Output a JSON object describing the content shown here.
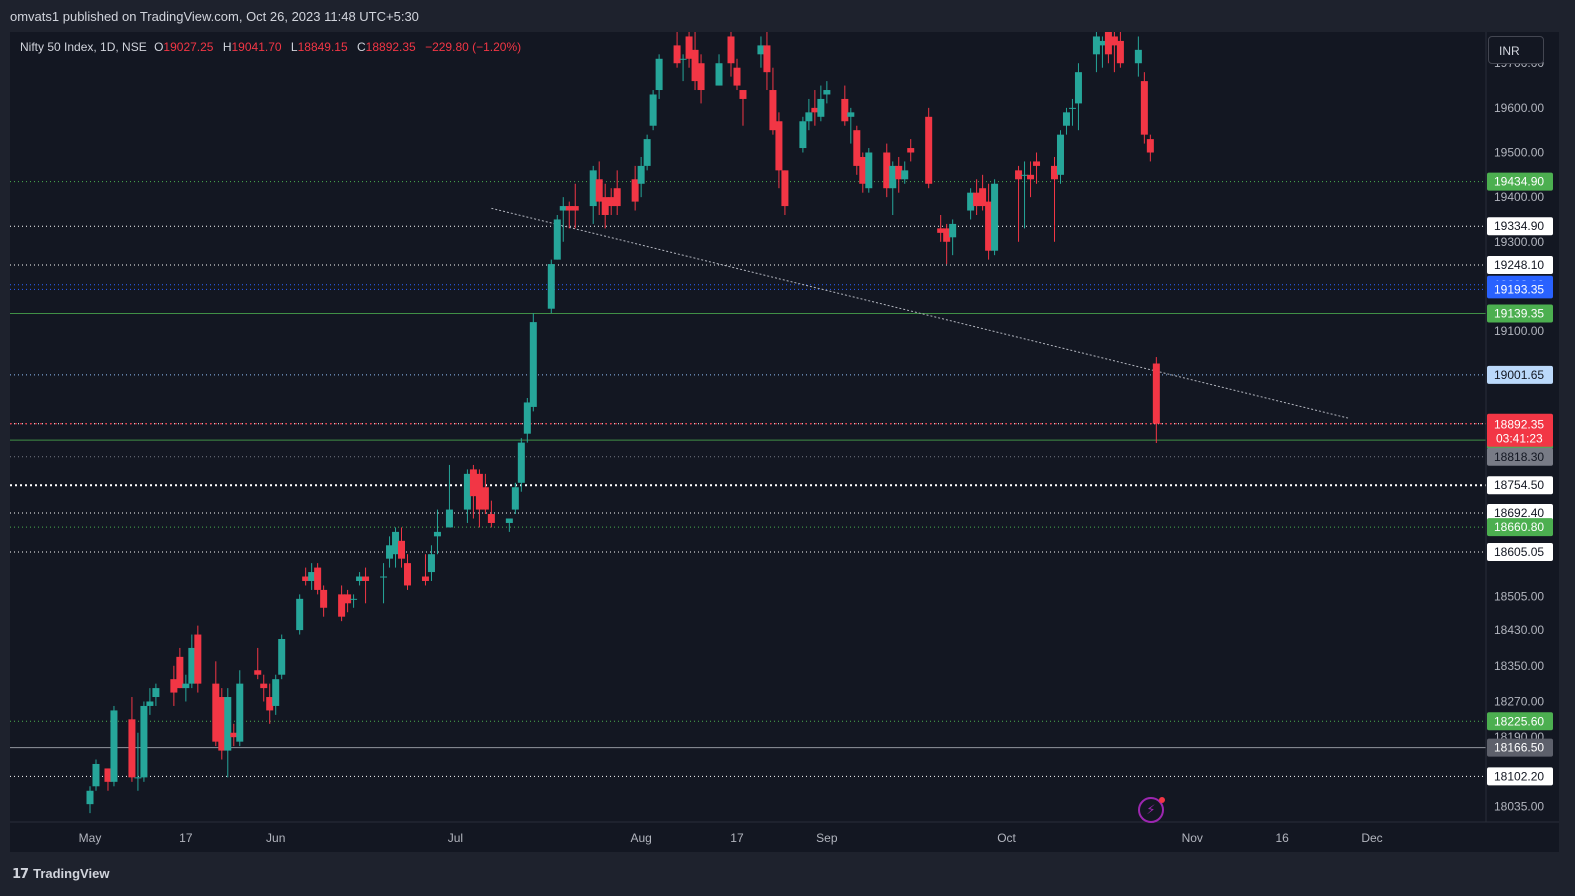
{
  "header": {
    "published": "omvats1 published on TradingView.com, Oct 26, 2023 11:48 UTC+5:30"
  },
  "legend": {
    "title": "Nifty 50 Index, 1D, NSE",
    "o_label": "O",
    "o_value": "19027.25",
    "h_label": "H",
    "h_value": "19041.70",
    "l_label": "L",
    "l_value": "18849.15",
    "c_label": "C",
    "c_value": "18892.35",
    "change": "−229.80 (−1.20%)"
  },
  "currency_button": "INR",
  "footer": {
    "brand": "TradingView"
  },
  "icons": {
    "lightning": "lightning-icon",
    "logo": "tradingview-logo-icon"
  },
  "colors": {
    "background": "#131722",
    "up": "#26a69a",
    "down": "#f23645",
    "green_level": "#4caf50",
    "blue_level": "#2962ff",
    "text": "#d1d4dc"
  },
  "chart_data": {
    "type": "candlestick",
    "title": "Nifty 50 Index, 1D, NSE",
    "currency": "INR",
    "ylim": [
      18000,
      19770
    ],
    "price_axis_ticks": [
      "19700.00",
      "19600.00",
      "19500.00",
      "19400.00",
      "19300.00",
      "19100.00",
      "18505.00",
      "18430.00",
      "18350.00",
      "18270.00",
      "18190.00",
      "18035.00"
    ],
    "time_axis_labels": [
      "May",
      "17",
      "Jun",
      "Jul",
      "Aug",
      "17",
      "Sep",
      "Oct",
      "Nov",
      "16",
      "Dec"
    ],
    "time_axis_dates": [
      "2023-05-01",
      "2023-05-17",
      "2023-06-01",
      "2023-07-01",
      "2023-08-01",
      "2023-08-17",
      "2023-09-01",
      "2023-10-01",
      "2023-11-01",
      "2023-11-16",
      "2023-12-01"
    ],
    "last_price": {
      "value": "18892.35",
      "countdown": "03:41:23"
    },
    "levels": [
      {
        "price": 19434.9,
        "label": "19434.90",
        "style": "dotted",
        "color": "#4caf50"
      },
      {
        "price": 19334.9,
        "label": "19334.90",
        "style": "dotted",
        "color": "#ffffff"
      },
      {
        "price": 19248.1,
        "label": "19248.10",
        "style": "dotted",
        "color": "#ffffff"
      },
      {
        "price": 19203.8,
        "label": "19203.80",
        "style": "dotted",
        "color": "#2962ff"
      },
      {
        "price": 19193.35,
        "label": "19193.35",
        "style": "dotted",
        "color": "#2962ff"
      },
      {
        "price": 19139.35,
        "label": "19139.35",
        "style": "solid",
        "color": "#4caf50"
      },
      {
        "price": 19001.65,
        "label": "19001.65",
        "style": "dotted",
        "color": "#90bff9"
      },
      {
        "price": 18892.2,
        "label": "18892.20",
        "style": "dotted",
        "color": "#ffffff"
      },
      {
        "price": 18855.7,
        "label": "18855.70",
        "style": "solid",
        "color": "#4caf50"
      },
      {
        "price": 18818.3,
        "label": "18818.30",
        "style": "dotted",
        "color": "#787b86"
      },
      {
        "price": 18754.5,
        "label": "18754.50",
        "style": "dotted-bold",
        "color": "#ffffff"
      },
      {
        "price": 18692.4,
        "label": "18692.40",
        "style": "dotted",
        "color": "#ffffff"
      },
      {
        "price": 18660.8,
        "label": "18660.80",
        "style": "dotted",
        "color": "#4caf50"
      },
      {
        "price": 18605.05,
        "label": "18605.05",
        "style": "dotted",
        "color": "#ffffff"
      },
      {
        "price": 18225.6,
        "label": "18225.60",
        "style": "dotted",
        "color": "#4caf50"
      },
      {
        "price": 18166.5,
        "label": "18166.50",
        "style": "solid",
        "color": "#b2b5be"
      },
      {
        "price": 18102.2,
        "label": "18102.20",
        "style": "dotted",
        "color": "#ffffff"
      }
    ],
    "trendline": {
      "from": {
        "date": "2023-07-07",
        "price": 19375
      },
      "to": {
        "date": "2023-11-27",
        "price": 18905
      }
    },
    "candles": [
      {
        "d": "2023-05-01",
        "o": 18040,
        "h": 18080,
        "l": 18020,
        "c": 18070
      },
      {
        "d": "2023-05-02",
        "o": 18080,
        "h": 18140,
        "l": 18070,
        "c": 18130
      },
      {
        "d": "2023-05-04",
        "o": 18120,
        "h": 18120,
        "l": 18070,
        "c": 18090
      },
      {
        "d": "2023-05-05",
        "o": 18090,
        "h": 18260,
        "l": 18080,
        "c": 18250
      },
      {
        "d": "2023-05-08",
        "o": 18230,
        "h": 18280,
        "l": 18090,
        "c": 18100
      },
      {
        "d": "2023-05-09",
        "o": 18100,
        "h": 18200,
        "l": 18070,
        "c": 18100
      },
      {
        "d": "2023-05-10",
        "o": 18100,
        "h": 18270,
        "l": 18090,
        "c": 18260
      },
      {
        "d": "2023-05-11",
        "o": 18260,
        "h": 18300,
        "l": 18240,
        "c": 18270
      },
      {
        "d": "2023-05-12",
        "o": 18280,
        "h": 18310,
        "l": 18260,
        "c": 18300
      },
      {
        "d": "2023-05-15",
        "o": 18320,
        "h": 18350,
        "l": 18260,
        "c": 18290
      },
      {
        "d": "2023-05-16",
        "o": 18370,
        "h": 18390,
        "l": 18300,
        "c": 18300
      },
      {
        "d": "2023-05-17",
        "o": 18300,
        "h": 18330,
        "l": 18270,
        "c": 18310
      },
      {
        "d": "2023-05-18",
        "o": 18310,
        "h": 18420,
        "l": 18300,
        "c": 18390
      },
      {
        "d": "2023-05-19",
        "o": 18420,
        "h": 18440,
        "l": 18290,
        "c": 18310
      },
      {
        "d": "2023-05-22",
        "o": 18310,
        "h": 18360,
        "l": 18170,
        "c": 18180
      },
      {
        "d": "2023-05-23",
        "o": 18280,
        "h": 18300,
        "l": 18140,
        "c": 18160
      },
      {
        "d": "2023-05-24",
        "o": 18160,
        "h": 18300,
        "l": 18100,
        "c": 18280
      },
      {
        "d": "2023-05-25",
        "o": 18200,
        "h": 18220,
        "l": 18170,
        "c": 18190
      },
      {
        "d": "2023-05-26",
        "o": 18180,
        "h": 18340,
        "l": 18170,
        "c": 18310
      },
      {
        "d": "2023-05-29",
        "o": 18340,
        "h": 18390,
        "l": 18320,
        "c": 18330
      },
      {
        "d": "2023-05-30",
        "o": 18310,
        "h": 18330,
        "l": 18270,
        "c": 18300
      },
      {
        "d": "2023-05-31",
        "o": 18280,
        "h": 18310,
        "l": 18220,
        "c": 18250
      },
      {
        "d": "2023-06-01",
        "o": 18260,
        "h": 18330,
        "l": 18240,
        "c": 18320
      },
      {
        "d": "2023-06-02",
        "o": 18330,
        "h": 18420,
        "l": 18320,
        "c": 18410
      },
      {
        "d": "2023-06-05",
        "o": 18430,
        "h": 18510,
        "l": 18420,
        "c": 18500
      },
      {
        "d": "2023-06-06",
        "o": 18550,
        "h": 18570,
        "l": 18530,
        "c": 18540
      },
      {
        "d": "2023-06-07",
        "o": 18540,
        "h": 18580,
        "l": 18520,
        "c": 18560
      },
      {
        "d": "2023-06-08",
        "o": 18570,
        "h": 18580,
        "l": 18510,
        "c": 18520
      },
      {
        "d": "2023-06-09",
        "o": 18520,
        "h": 18530,
        "l": 18460,
        "c": 18480
      },
      {
        "d": "2023-06-12",
        "o": 18510,
        "h": 18530,
        "l": 18450,
        "c": 18460
      },
      {
        "d": "2023-06-13",
        "o": 18510,
        "h": 18520,
        "l": 18470,
        "c": 18490
      },
      {
        "d": "2023-06-14",
        "o": 18500,
        "h": 18510,
        "l": 18480,
        "c": 18500
      },
      {
        "d": "2023-06-15",
        "o": 18540,
        "h": 18560,
        "l": 18530,
        "c": 18550
      },
      {
        "d": "2023-06-16",
        "o": 18550,
        "h": 18570,
        "l": 18490,
        "c": 18540
      },
      {
        "d": "2023-06-19",
        "o": 18550,
        "h": 18580,
        "l": 18490,
        "c": 18550
      },
      {
        "d": "2023-06-20",
        "o": 18590,
        "h": 18640,
        "l": 18570,
        "c": 18620
      },
      {
        "d": "2023-06-21",
        "o": 18600,
        "h": 18660,
        "l": 18570,
        "c": 18650
      },
      {
        "d": "2023-06-22",
        "o": 18630,
        "h": 18660,
        "l": 18570,
        "c": 18590
      },
      {
        "d": "2023-06-23",
        "o": 18580,
        "h": 18600,
        "l": 18520,
        "c": 18530
      },
      {
        "d": "2023-06-26",
        "o": 18550,
        "h": 18600,
        "l": 18530,
        "c": 18540
      },
      {
        "d": "2023-06-27",
        "o": 18560,
        "h": 18620,
        "l": 18540,
        "c": 18600
      },
      {
        "d": "2023-06-28",
        "o": 18640,
        "h": 18700,
        "l": 18600,
        "c": 18650
      },
      {
        "d": "2023-06-30",
        "o": 18660,
        "h": 18800,
        "l": 18660,
        "c": 18700
      },
      {
        "d": "2023-07-03",
        "o": 18700,
        "h": 18790,
        "l": 18670,
        "c": 18780
      },
      {
        "d": "2023-07-04",
        "o": 18790,
        "h": 18800,
        "l": 18680,
        "c": 18730
      },
      {
        "d": "2023-07-05",
        "o": 18780,
        "h": 18790,
        "l": 18660,
        "c": 18700
      },
      {
        "d": "2023-07-06",
        "o": 18750,
        "h": 18780,
        "l": 18690,
        "c": 18700
      },
      {
        "d": "2023-07-07",
        "o": 18690,
        "h": 18720,
        "l": 18660,
        "c": 18670
      },
      {
        "d": "2023-07-10",
        "o": 18670,
        "h": 18680,
        "l": 18650,
        "c": 18680
      },
      {
        "d": "2023-07-11",
        "o": 18700,
        "h": 18760,
        "l": 18690,
        "c": 18750
      },
      {
        "d": "2023-07-12",
        "o": 18760,
        "h": 18860,
        "l": 18740,
        "c": 18850
      },
      {
        "d": "2023-07-13",
        "o": 18870,
        "h": 18950,
        "l": 18850,
        "c": 18940
      },
      {
        "d": "2023-07-14",
        "o": 18930,
        "h": 19140,
        "l": 18920,
        "c": 19120
      },
      {
        "d": "2023-07-17",
        "o": 19150,
        "h": 19260,
        "l": 19140,
        "c": 19250
      },
      {
        "d": "2023-07-18",
        "o": 19260,
        "h": 19360,
        "l": 19260,
        "c": 19350
      },
      {
        "d": "2023-07-19",
        "o": 19370,
        "h": 19400,
        "l": 19300,
        "c": 19380
      },
      {
        "d": "2023-07-20",
        "o": 19380,
        "h": 19390,
        "l": 19330,
        "c": 19370
      },
      {
        "d": "2023-07-21",
        "o": 19380,
        "h": 19430,
        "l": 19330,
        "c": 19370
      },
      {
        "d": "2023-07-24",
        "o": 19380,
        "h": 19470,
        "l": 19340,
        "c": 19460
      },
      {
        "d": "2023-07-25",
        "o": 19440,
        "h": 19480,
        "l": 19360,
        "c": 19390
      },
      {
        "d": "2023-07-26",
        "o": 19400,
        "h": 19430,
        "l": 19330,
        "c": 19360
      },
      {
        "d": "2023-07-27",
        "o": 19400,
        "h": 19420,
        "l": 19360,
        "c": 19380
      },
      {
        "d": "2023-07-28",
        "o": 19420,
        "h": 19460,
        "l": 19360,
        "c": 19380
      },
      {
        "d": "2023-07-31",
        "o": 19440,
        "h": 19470,
        "l": 19370,
        "c": 19390
      },
      {
        "d": "2023-08-01",
        "o": 19430,
        "h": 19490,
        "l": 19400,
        "c": 19470
      },
      {
        "d": "2023-08-02",
        "o": 19470,
        "h": 19540,
        "l": 19460,
        "c": 19530
      },
      {
        "d": "2023-08-03",
        "o": 19560,
        "h": 19640,
        "l": 19550,
        "c": 19630
      },
      {
        "d": "2023-08-04",
        "o": 19640,
        "h": 19720,
        "l": 19620,
        "c": 19710
      },
      {
        "d": "2023-08-07",
        "o": 19740,
        "h": 19770,
        "l": 19690,
        "c": 19700
      },
      {
        "d": "2023-08-08",
        "o": 19710,
        "h": 19720,
        "l": 19660,
        "c": 19710
      },
      {
        "d": "2023-08-09",
        "o": 19760,
        "h": 19770,
        "l": 19690,
        "c": 19710
      },
      {
        "d": "2023-08-10",
        "o": 19730,
        "h": 19770,
        "l": 19640,
        "c": 19660
      },
      {
        "d": "2023-08-11",
        "o": 19700,
        "h": 19720,
        "l": 19610,
        "c": 19640
      },
      {
        "d": "2023-08-14",
        "o": 19650,
        "h": 19720,
        "l": 19650,
        "c": 19700
      },
      {
        "d": "2023-08-16",
        "o": 19760,
        "h": 19770,
        "l": 19670,
        "c": 19700
      },
      {
        "d": "2023-08-17",
        "o": 19690,
        "h": 19710,
        "l": 19640,
        "c": 19650
      },
      {
        "d": "2023-08-18",
        "o": 19640,
        "h": 19640,
        "l": 19560,
        "c": 19620
      },
      {
        "d": "2023-08-21",
        "o": 19720,
        "h": 19760,
        "l": 19690,
        "c": 19740
      },
      {
        "d": "2023-08-22",
        "o": 19740,
        "h": 19770,
        "l": 19640,
        "c": 19680
      },
      {
        "d": "2023-08-23",
        "o": 19640,
        "h": 19690,
        "l": 19540,
        "c": 19550
      },
      {
        "d": "2023-08-24",
        "o": 19570,
        "h": 19590,
        "l": 19420,
        "c": 19460
      },
      {
        "d": "2023-08-25",
        "o": 19460,
        "h": 19460,
        "l": 19360,
        "c": 19380
      },
      {
        "d": "2023-08-28",
        "o": 19510,
        "h": 19580,
        "l": 19500,
        "c": 19570
      },
      {
        "d": "2023-08-29",
        "o": 19570,
        "h": 19620,
        "l": 19550,
        "c": 19590
      },
      {
        "d": "2023-08-30",
        "o": 19600,
        "h": 19640,
        "l": 19560,
        "c": 19590
      },
      {
        "d": "2023-08-31",
        "o": 19580,
        "h": 19650,
        "l": 19570,
        "c": 19620
      },
      {
        "d": "2023-09-01",
        "o": 19630,
        "h": 19660,
        "l": 19610,
        "c": 19640
      },
      {
        "d": "2023-09-04",
        "o": 19620,
        "h": 19650,
        "l": 19560,
        "c": 19570
      },
      {
        "d": "2023-09-05",
        "o": 19580,
        "h": 19600,
        "l": 19520,
        "c": 19590
      },
      {
        "d": "2023-09-06",
        "o": 19550,
        "h": 19560,
        "l": 19450,
        "c": 19470
      },
      {
        "d": "2023-09-07",
        "o": 19490,
        "h": 19500,
        "l": 19410,
        "c": 19430
      },
      {
        "d": "2023-09-08",
        "o": 19420,
        "h": 19510,
        "l": 19410,
        "c": 19500
      },
      {
        "d": "2023-09-11",
        "o": 19500,
        "h": 19520,
        "l": 19400,
        "c": 19420
      },
      {
        "d": "2023-09-12",
        "o": 19420,
        "h": 19480,
        "l": 19360,
        "c": 19470
      },
      {
        "d": "2023-09-13",
        "o": 19470,
        "h": 19490,
        "l": 19410,
        "c": 19440
      },
      {
        "d": "2023-09-14",
        "o": 19440,
        "h": 19480,
        "l": 19430,
        "c": 19460
      },
      {
        "d": "2023-09-15",
        "o": 19510,
        "h": 19530,
        "l": 19480,
        "c": 19500
      },
      {
        "d": "2023-09-18",
        "o": 19580,
        "h": 19600,
        "l": 19420,
        "c": 19430
      },
      {
        "d": "2023-09-20",
        "o": 19330,
        "h": 19360,
        "l": 19300,
        "c": 19320
      },
      {
        "d": "2023-09-21",
        "o": 19330,
        "h": 19340,
        "l": 19250,
        "c": 19300
      },
      {
        "d": "2023-09-22",
        "o": 19310,
        "h": 19350,
        "l": 19270,
        "c": 19340
      },
      {
        "d": "2023-09-25",
        "o": 19370,
        "h": 19420,
        "l": 19350,
        "c": 19410
      },
      {
        "d": "2023-09-26",
        "o": 19410,
        "h": 19440,
        "l": 19360,
        "c": 19380
      },
      {
        "d": "2023-09-27",
        "o": 19420,
        "h": 19450,
        "l": 19370,
        "c": 19380
      },
      {
        "d": "2023-09-28",
        "o": 19390,
        "h": 19430,
        "l": 19260,
        "c": 19280
      },
      {
        "d": "2023-09-29",
        "o": 19280,
        "h": 19440,
        "l": 19270,
        "c": 19430
      },
      {
        "d": "2023-10-03",
        "o": 19460,
        "h": 19470,
        "l": 19300,
        "c": 19440
      },
      {
        "d": "2023-10-04",
        "o": 19450,
        "h": 19480,
        "l": 19330,
        "c": 19450
      },
      {
        "d": "2023-10-05",
        "o": 19450,
        "h": 19480,
        "l": 19400,
        "c": 19440
      },
      {
        "d": "2023-10-06",
        "o": 19480,
        "h": 19500,
        "l": 19430,
        "c": 19470
      },
      {
        "d": "2023-10-09",
        "o": 19470,
        "h": 19490,
        "l": 19300,
        "c": 19440
      },
      {
        "d": "2023-10-10",
        "o": 19450,
        "h": 19550,
        "l": 19430,
        "c": 19540
      },
      {
        "d": "2023-10-11",
        "o": 19560,
        "h": 19600,
        "l": 19540,
        "c": 19590
      },
      {
        "d": "2023-10-12",
        "o": 19600,
        "h": 19620,
        "l": 19560,
        "c": 19600
      },
      {
        "d": "2023-10-13",
        "o": 19610,
        "h": 19700,
        "l": 19550,
        "c": 19680
      },
      {
        "d": "2023-10-16",
        "o": 19720,
        "h": 19770,
        "l": 19680,
        "c": 19760
      },
      {
        "d": "2023-10-17",
        "o": 19740,
        "h": 19760,
        "l": 19690,
        "c": 19750
      },
      {
        "d": "2023-10-18",
        "o": 19770,
        "h": 19770,
        "l": 19700,
        "c": 19720
      },
      {
        "d": "2023-10-19",
        "o": 19760,
        "h": 19770,
        "l": 19680,
        "c": 19740
      },
      {
        "d": "2023-10-20",
        "o": 19750,
        "h": 19770,
        "l": 19690,
        "c": 19700
      },
      {
        "d": "2023-10-23",
        "o": 19700,
        "h": 19760,
        "l": 19670,
        "c": 19730
      },
      {
        "d": "2023-10-24",
        "o": 19660,
        "h": 19680,
        "l": 19520,
        "c": 19540
      },
      {
        "d": "2023-10-25",
        "o": 19530,
        "h": 19540,
        "l": 19480,
        "c": 19500
      },
      {
        "d": "2023-10-26",
        "o": 19027.25,
        "h": 19041.7,
        "l": 18849.15,
        "c": 18892.35
      }
    ]
  }
}
